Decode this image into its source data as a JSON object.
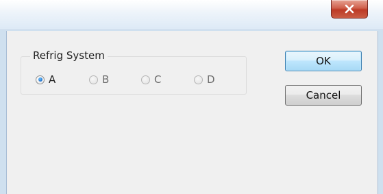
{
  "window": {
    "close_glyph": "x"
  },
  "group": {
    "label": "Refrig System",
    "options": [
      {
        "label": "A",
        "checked": true,
        "enabled": true
      },
      {
        "label": "B",
        "checked": false,
        "enabled": false
      },
      {
        "label": "C",
        "checked": false,
        "enabled": false
      },
      {
        "label": "D",
        "checked": false,
        "enabled": false
      }
    ]
  },
  "buttons": {
    "ok_label": "OK",
    "cancel_label": "Cancel"
  },
  "colors": {
    "close_button": "#c4472f",
    "default_button_border": "#3c7fb1",
    "selected_radio": "#1f6ec9",
    "dialog_background": "#f0f0f0"
  }
}
